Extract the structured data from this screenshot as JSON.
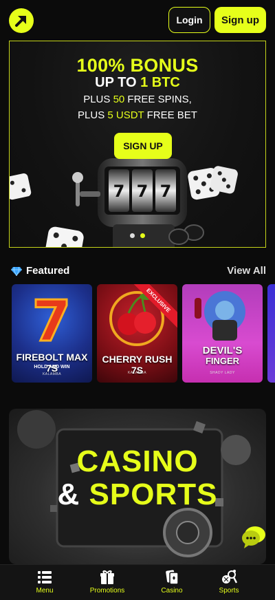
{
  "header": {
    "login_label": "Login",
    "signup_label": "Sign up"
  },
  "banner": {
    "title": "100% BONUS",
    "sub_prefix": "UP TO ",
    "sub_highlight": "1 BTC",
    "line1_prefix": "PLUS ",
    "line1_highlight": "50",
    "line1_suffix": " FREE SPINS,",
    "line2_prefix": "PLUS ",
    "line2_highlight": "5 USDT",
    "line2_suffix": " FREE BET",
    "cta_label": "SIGN UP",
    "slides": 2,
    "active_slide": 2
  },
  "featured": {
    "title": "Featured",
    "view_all_label": "View All",
    "games": [
      {
        "name": "FIREBOLT MAX 7S",
        "tagline": "HOLD AND WIN",
        "provider": "KALAMBA"
      },
      {
        "name": "CHERRY RUSH 7S",
        "badge": "EXCLUSIVE",
        "provider": "KALAMBA"
      },
      {
        "name_line1": "DEVIL'S",
        "name_line2": "FINGER",
        "provider": "SHADY LADY"
      }
    ]
  },
  "promo": {
    "line1": "CASINO",
    "amp": "&",
    "line2": "SPORTS"
  },
  "bottom_nav": {
    "items": [
      {
        "label": "Menu",
        "icon": "menu-icon"
      },
      {
        "label": "Promotions",
        "icon": "gift-icon"
      },
      {
        "label": "Casino",
        "icon": "cards-icon"
      },
      {
        "label": "Sports",
        "icon": "sports-icon"
      }
    ]
  },
  "colors": {
    "accent": "#e6ff1a",
    "background": "#0b0b0b"
  }
}
